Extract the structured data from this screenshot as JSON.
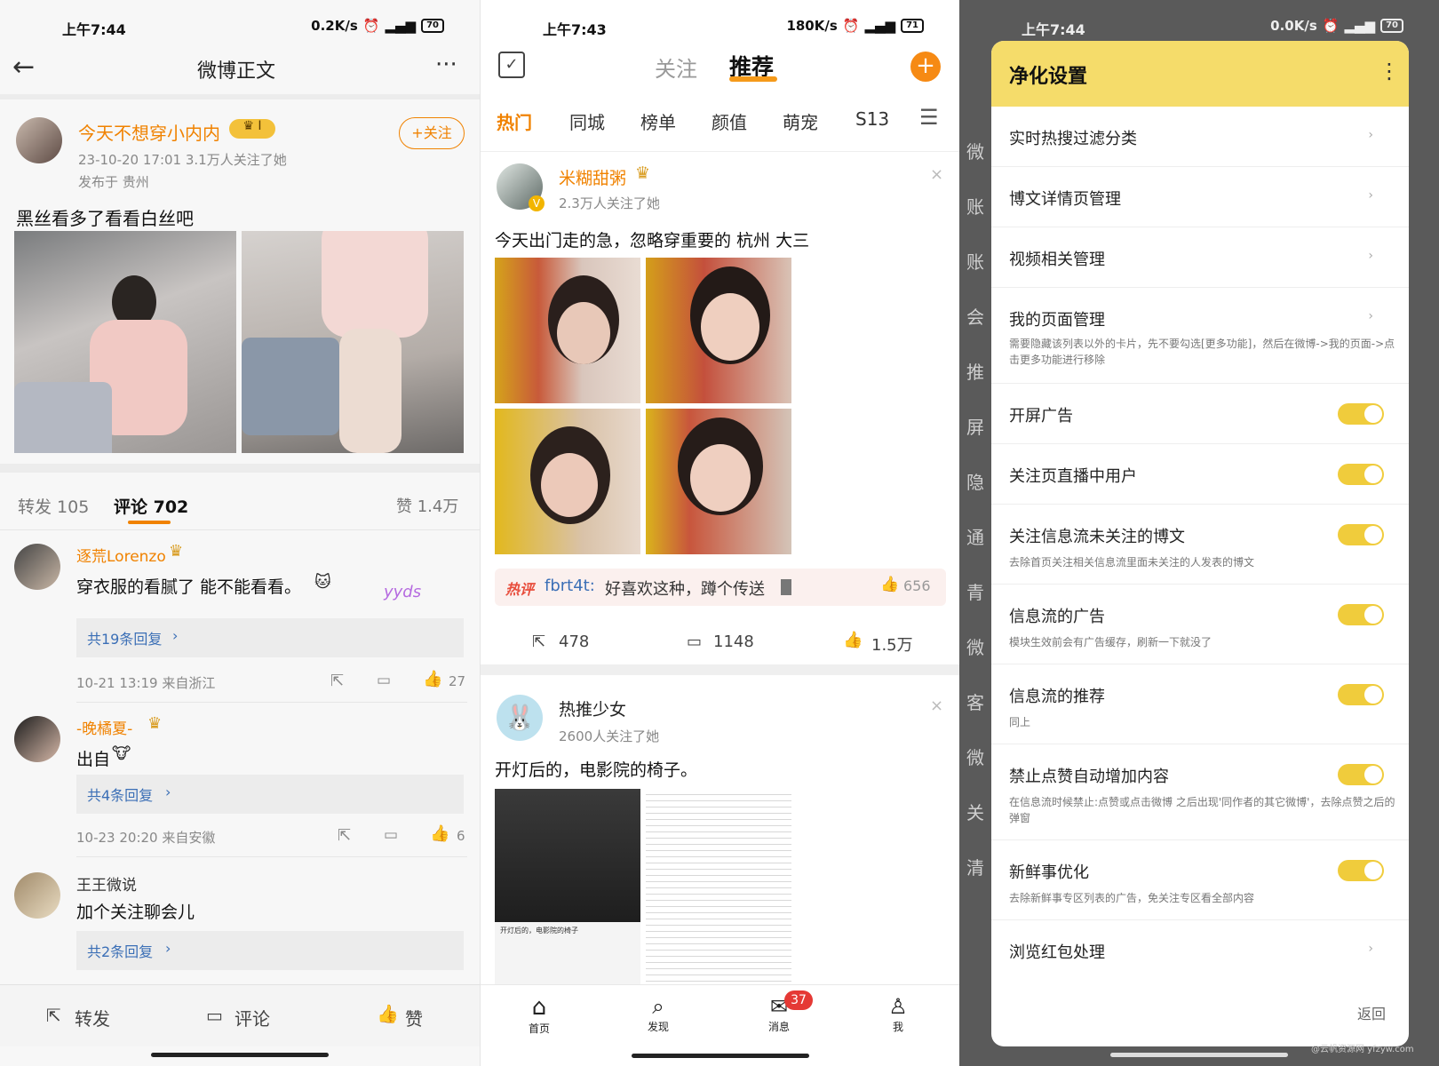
{
  "p1": {
    "status": {
      "time": "上午7:44",
      "speed": "0.2K/s",
      "battery": "70"
    },
    "title": "微博正文",
    "post": {
      "author": "今天不想穿小内内",
      "meta": "23-10-20 17:01  3.1万人关注了她",
      "location": "发布于 贵州",
      "follow": "+关注",
      "text": "黑丝看多了看看白丝吧"
    },
    "stats": {
      "repost": "转发 105",
      "comment": "评论 702",
      "like": "赞 1.4万"
    },
    "comments": [
      {
        "name": "逐荒Lorenzo",
        "text": "穿衣服的看腻了 能不能看看。",
        "replies": "共19条回复",
        "time": "10-21 13:19  来自浙江",
        "likes": "27"
      },
      {
        "name": "-晚橘夏-",
        "text": "出自",
        "replies": "共4条回复",
        "time": "10-23 20:20  来自安徽",
        "likes": "6"
      },
      {
        "name": "王王微说",
        "text": "加个关注聊会儿",
        "replies": "共2条回复"
      }
    ],
    "bottom": {
      "repost": "转发",
      "comment": "评论",
      "like": "赞"
    }
  },
  "p2": {
    "status": {
      "time": "上午7:43",
      "speed": "180K/s",
      "battery": "71"
    },
    "top_tabs": {
      "follow": "关注",
      "recommend": "推荐"
    },
    "channels": [
      "热门",
      "同城",
      "榜单",
      "颜值",
      "萌宠",
      "S13"
    ],
    "post1": {
      "author": "米糊甜粥",
      "followers": "2.3万人关注了她",
      "text": "今天出门走的急，忽略穿重要的   杭州 大三",
      "hot_badge": "热评",
      "hot_user": "fbrt4t:",
      "hot_text": "好喜欢这种，蹲个传送",
      "hot_likes": "656",
      "reposts": "478",
      "comments": "1148",
      "likes": "1.5万"
    },
    "post2": {
      "author": "热推少女",
      "followers": "2600人关注了她",
      "text": "开灯后的，电影院的椅子。",
      "thumb_caption": "开灯后的，电影院的椅子"
    },
    "nav": {
      "home": "首页",
      "discover": "发现",
      "messages": "消息",
      "me": "我",
      "badge": "37"
    }
  },
  "p3": {
    "status": {
      "time": "上午7:44",
      "speed": "0.0K/s",
      "battery": "70"
    },
    "dialog_title": "净化设置",
    "items": [
      {
        "label": "实时热搜过滤分类"
      },
      {
        "label": "博文详情页管理"
      },
      {
        "label": "视频相关管理"
      },
      {
        "label": "我的页面管理",
        "desc": "需要隐藏该列表以外的卡片，先不要勾选[更多功能]，然后在微博->我的页面->点击更多功能进行移除"
      },
      {
        "label": "开屏广告"
      },
      {
        "label": "关注页直播中用户"
      },
      {
        "label": "关注信息流未关注的博文",
        "desc": "去除首页关注相关信息流里面未关注的人发表的博文"
      },
      {
        "label": "信息流的广告",
        "desc": "模块生效前会有广告缓存，刷新一下就没了"
      },
      {
        "label": "信息流的推荐",
        "desc": "同上"
      },
      {
        "label": "禁止点赞自动增加内容",
        "desc": "在信息流时候禁止:点赞或点击微博 之后出现'同作者的其它微博'，去除点赞之后的弹窗"
      },
      {
        "label": "新鲜事优化",
        "desc": "去除新鲜事专区列表的广告，免关注专区看全部内容"
      },
      {
        "label": "浏览红包处理"
      }
    ],
    "back": "返回",
    "bg_letters": [
      "微",
      "账",
      "账",
      "会",
      "推",
      "屏",
      "隐",
      "通",
      "青",
      "微",
      "客",
      "微",
      "关",
      "清"
    ],
    "watermark": "@云帆资源网 yfzyw.com"
  },
  "colors": {
    "accent": "#f08200",
    "toggle": "#f0cc3c",
    "dialog_header": "#f5dc6a",
    "badge": "#e53935"
  }
}
